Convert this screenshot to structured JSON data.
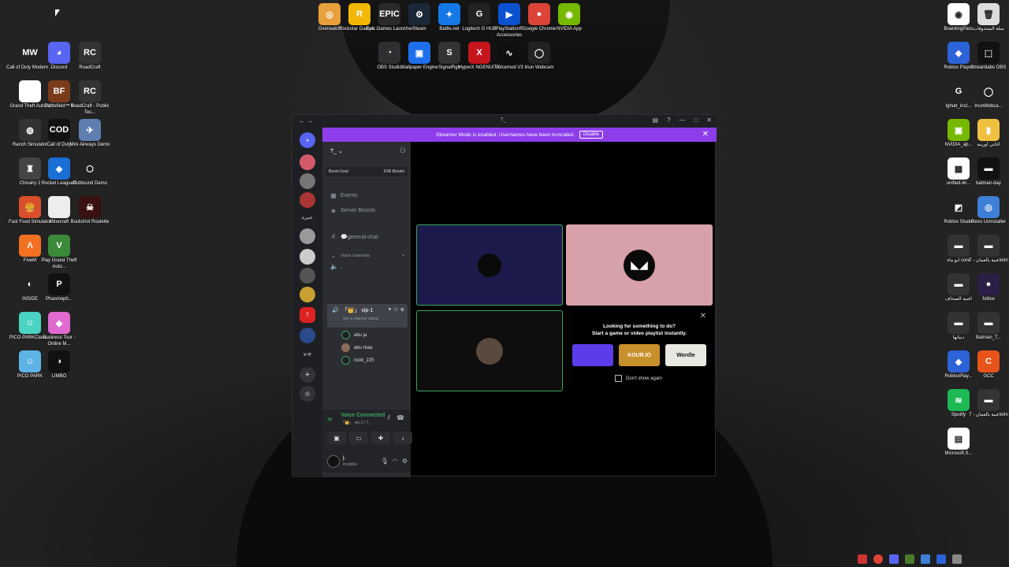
{
  "desktop": {
    "top_icons": [
      {
        "label": "Overwatch",
        "color": "#e8a03a",
        "glyph": "◎"
      },
      {
        "label": "Rockstar Games ...",
        "color": "#f2b705",
        "glyph": "R"
      },
      {
        "label": "Epic Games Launcher",
        "color": "#2a2a2a",
        "glyph": "EPIC"
      },
      {
        "label": "Steam",
        "color": "#1b2838",
        "glyph": "⚙"
      },
      {
        "label": "Battle.net",
        "color": "#1478e6",
        "glyph": "✦"
      },
      {
        "label": "Logitech G HUB",
        "color": "#222",
        "glyph": "G"
      },
      {
        "label": "PlayStation® Accessories",
        "color": "#0b52d1",
        "glyph": "▶"
      },
      {
        "label": "Google Chrome",
        "color": "#db4437",
        "glyph": "●"
      },
      {
        "label": "NVIDIA App",
        "color": "#76b900",
        "glyph": "◉"
      }
    ],
    "top_icons_row2": [
      {
        "label": "OBS Studio",
        "color": "#302e31",
        "glyph": "◔"
      },
      {
        "label": "Wallpaper Engine",
        "color": "#1f6feb",
        "glyph": "▣"
      },
      {
        "label": "SignalRgb",
        "color": "#333",
        "glyph": "S"
      },
      {
        "label": "HyperX NGENUITY",
        "color": "#c4161c",
        "glyph": "X"
      },
      {
        "label": "Voicemod V3",
        "color": "#0f0f0f",
        "glyph": "∿"
      },
      {
        "label": "Iriun Webcam",
        "color": "#222",
        "glyph": "◯"
      }
    ],
    "left_icons": [
      {
        "label": "Call of Duty Modern ...",
        "color": "#222",
        "glyph": "MW"
      },
      {
        "label": "Discord",
        "color": "#5865f2",
        "glyph": "◕"
      },
      {
        "label": "RoadCraft",
        "color": "#333",
        "glyph": "RC"
      },
      {
        "label": "Grand Theft Auto V",
        "color": "#fff",
        "glyph": ""
      },
      {
        "label": "Battlefield™ 6",
        "color": "#7a3b1a",
        "glyph": "BF"
      },
      {
        "label": "RoadCraft - Public Tes...",
        "color": "#333",
        "glyph": "RC"
      },
      {
        "label": "Ranch Simulator",
        "color": "#333",
        "glyph": "◍"
      },
      {
        "label": "Call of Duty",
        "color": "#111",
        "glyph": "COD"
      },
      {
        "label": "Mini Airways Demo",
        "color": "#5e7fb0",
        "glyph": "✈"
      },
      {
        "label": "Chivalry 2",
        "color": "#444",
        "glyph": "♜"
      },
      {
        "label": "Rocket League®",
        "color": "#1a6fd6",
        "glyph": "◈"
      },
      {
        "label": "Outbound Demo",
        "color": "#222",
        "glyph": "⬡"
      },
      {
        "label": "Fast Food Simulator",
        "color": "#d94f2b",
        "glyph": "🍔"
      },
      {
        "label": "Minecraft",
        "color": "#eee",
        "glyph": ""
      },
      {
        "label": "Buckshot Roulette",
        "color": "#3a1010",
        "glyph": "☠"
      },
      {
        "label": "FiveM",
        "color": "#f37021",
        "glyph": "Λ"
      },
      {
        "label": "Play Grand Theft Auto...",
        "color": "#3a8a3a",
        "glyph": "V"
      },
      {
        "label": "INSIDE",
        "color": "#222",
        "glyph": "◐"
      },
      {
        "label": "Phasmoph...",
        "color": "#111",
        "glyph": "P"
      },
      {
        "label": "PICO PARKClass...",
        "color": "#4ad3c3",
        "glyph": "☺"
      },
      {
        "label": "Business Tour - Online M...",
        "color": "#e06ad0",
        "glyph": "◆"
      },
      {
        "label": "PICO PARK",
        "color": "#5db3e6",
        "glyph": "☺"
      },
      {
        "label": "LIMBO",
        "color": "#111",
        "glyph": "◑"
      }
    ],
    "right_icons": [
      {
        "label": "BoardingPass",
        "color": "#fff",
        "glyph": "◉"
      },
      {
        "label": "سلة المحذوفات",
        "color": "#ddd",
        "glyph": "🗑"
      },
      {
        "label": "Roblox Player",
        "color": "#2d63d8",
        "glyph": "◆"
      },
      {
        "label": "Streamlabs OBS",
        "color": "#111",
        "glyph": "⬚"
      },
      {
        "label": "lghub_inst...",
        "color": "#222",
        "glyph": "G"
      },
      {
        "label": "IriunWebca...",
        "color": "#222",
        "glyph": "◯"
      },
      {
        "label": "NVIDIA_ap...",
        "color": "#76b900",
        "glyph": "▣"
      },
      {
        "label": "اغاني اوربيه",
        "color": "#f0c040",
        "glyph": "▮"
      },
      {
        "label": "unified-lin...",
        "color": "#fff",
        "glyph": "▦"
      },
      {
        "label": "batman-day",
        "color": "#111",
        "glyph": "▬"
      },
      {
        "label": "Roblox Studio",
        "color": "#222",
        "glyph": "◩"
      },
      {
        "label": "Revo Uninstaller",
        "color": "#3d7fd6",
        "glyph": "◎"
      },
      {
        "label": "ابو ماء core",
        "color": "#333",
        "glyph": "▬"
      },
      {
        "label": "اغنية بالعمان - 7elm",
        "color": "#333",
        "glyph": "▬"
      },
      {
        "label": "اغنية الصحاف",
        "color": "#333",
        "glyph": "▬"
      },
      {
        "label": "follow",
        "color": "#2c1f45",
        "glyph": "●"
      },
      {
        "label": "دنيانها",
        "color": "#333",
        "glyph": "▬"
      },
      {
        "label": "Batman_T...",
        "color": "#333",
        "glyph": "▬"
      },
      {
        "label": "RobloxPlay...",
        "color": "#2d63d8",
        "glyph": "◆"
      },
      {
        "label": "GCC",
        "color": "#e8531a",
        "glyph": "C"
      },
      {
        "label": "Spotify",
        "color": "#1db954",
        "glyph": "≋"
      },
      {
        "label": "اغنية بالعمان - 7elm",
        "color": "#333",
        "glyph": "▬"
      },
      {
        "label": "Microsoft.S...",
        "color": "#fff",
        "glyph": "▤"
      }
    ]
  },
  "discord": {
    "window_title": "T_",
    "banner": {
      "text": "Streamer Mode is enabled. Usernames have been truncated.",
      "button": "Disable"
    },
    "server": {
      "name": "T_",
      "boost_goal": "Boost Goal",
      "boost_count": "0/36 Boosts"
    },
    "guild_labels": [
      "عبيرة",
      "v-e"
    ],
    "channels": {
      "events": "Events",
      "server_boosts": "Server Boosts",
      "text_channel": "💬general-chat",
      "voice_category": "Voice channels",
      "voice_first": ",",
      "active_voice": "「👑」 vip-1",
      "voice_status": "Set a channel status",
      "members": [
        "abu ja",
        "abu maa",
        "roob_225"
      ]
    },
    "voice_panel": {
      "status": "Voice Connected",
      "channel": "「👑」 vip-1 / T_"
    },
    "user_panel": {
      "name": "j.",
      "status": "Invisible"
    },
    "activity": {
      "title": "Looking for something to do?",
      "subtitle": "Start a game or video playlist instantly.",
      "games": [
        {
          "name": "",
          "color": "#5b3ce8"
        },
        {
          "name": "KOUR.IO",
          "color": "#c8902a"
        },
        {
          "name": "Wordle",
          "color": "#e8e8e0"
        }
      ],
      "dont_show": "Don't show again"
    }
  }
}
